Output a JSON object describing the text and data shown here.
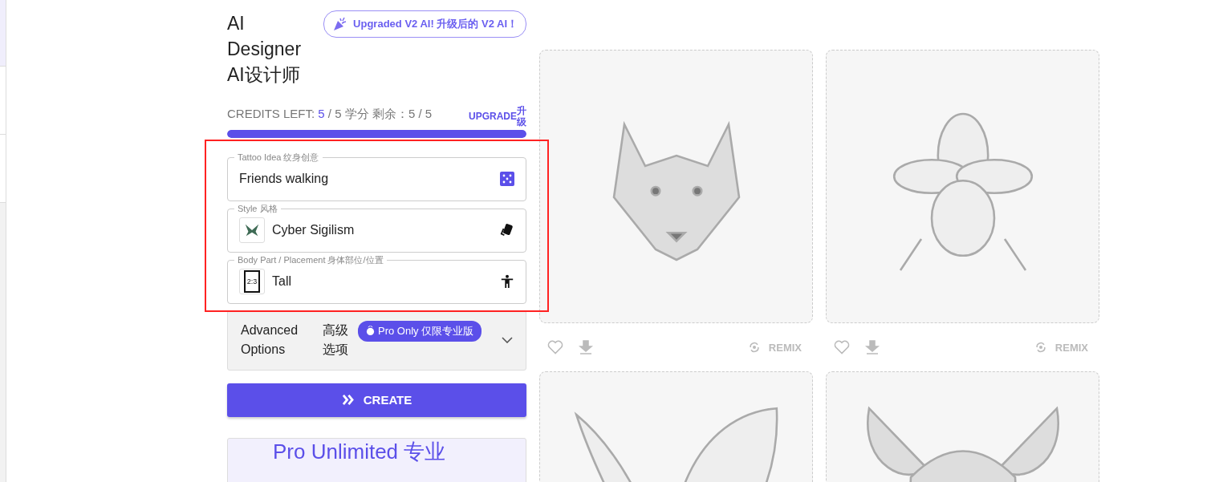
{
  "title": "AI Designer AI设计师",
  "announcement": "Upgraded V2 AI! 升级后的 V2 AI！",
  "credits": {
    "label": "CREDITS LEFT:",
    "value": "5",
    "rest": "/ 5 学分 剩余：5 / 5",
    "upgrade": "UPGRADE",
    "upgrade_cn": "升级",
    "level": 1
  },
  "fields": [
    {
      "kind": "text",
      "label": "Tattoo Idea 纹身创意",
      "value": "Friends walking"
    },
    {
      "kind": "style",
      "label": "Style 风格",
      "value": "Cyber Sigilism"
    },
    {
      "kind": "placement",
      "label": "Body Part / Placement 身体部位/位置",
      "value": "Tall",
      "thumb_text": "2:3"
    }
  ],
  "advanced": {
    "label": "Advanced Options",
    "label_cn": "高级选项",
    "badge": "Pro Only 仅限专业版",
    "expanded": false
  },
  "create_button": "CREATE",
  "promo": "Pro Unlimited 专业",
  "gallery": [
    {
      "kind": "wolf",
      "remix": "REMIX"
    },
    {
      "kind": "flower",
      "remix": "REMIX"
    },
    {
      "kind": "butterfly"
    },
    {
      "kind": "mask"
    }
  ]
}
